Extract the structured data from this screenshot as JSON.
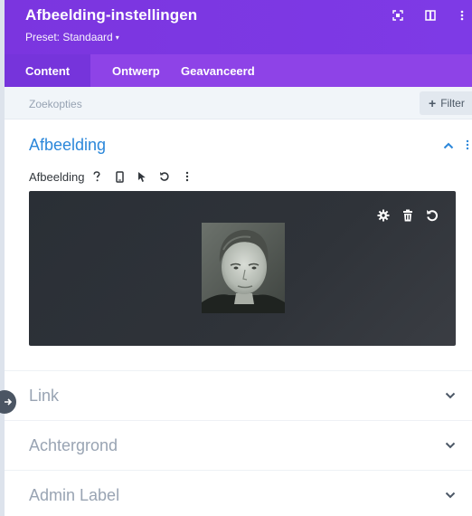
{
  "header": {
    "title": "Afbeelding-instellingen",
    "preset": "Preset: Standaard",
    "preset_caret": "▾",
    "background_color": "#7b35df"
  },
  "tabs": [
    {
      "label": "Content",
      "active": true
    },
    {
      "label": "Ontwerp",
      "active": false
    },
    {
      "label": "Geavanceerd",
      "active": false
    }
  ],
  "search": {
    "placeholder": "Zoekopties",
    "filter_label": "Filter",
    "filter_icon": "plus-icon"
  },
  "sections": {
    "image": {
      "title": "Afbeelding",
      "expanded": true,
      "field_label": "Afbeelding",
      "field_icons": [
        "help-icon",
        "mobile-icon",
        "hover-cursor-icon",
        "reset-icon",
        "more-icon"
      ],
      "image_toolbar": [
        "settings-gear-icon",
        "trash-icon",
        "reset-icon"
      ]
    },
    "link": {
      "title": "Link",
      "expanded": false
    },
    "background": {
      "title": "Achtergrond",
      "expanded": false
    },
    "admin": {
      "title": "Admin Label",
      "expanded": false
    }
  },
  "colors": {
    "accent": "#2b87da",
    "header": "#7b35df",
    "tabs": "#8e43e7",
    "collapsed_title": "#99a4b3"
  }
}
